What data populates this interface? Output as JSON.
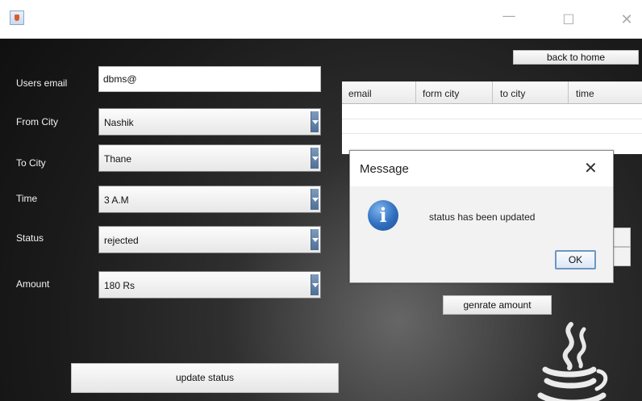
{
  "window": {
    "minimize_glyph": "—",
    "maximize_glyph": "☐",
    "close_glyph": "✕"
  },
  "form": {
    "email_label": "Users email",
    "email_value": "dbms@",
    "from_label": "From City",
    "from_value": "Nashik",
    "to_label": "To City",
    "to_value": "Thane",
    "time_label": "Time",
    "time_value": "3  A.M",
    "status_label": "Status",
    "status_value": "rejected",
    "amount_label": "Amount",
    "amount_value": "180 Rs",
    "update_button": "update status"
  },
  "actions": {
    "back_button": "back to home",
    "generate_button": "genrate amount"
  },
  "table": {
    "columns": [
      "email",
      "form city",
      "to city",
      "time"
    ]
  },
  "dialog": {
    "title": "Message",
    "close_glyph": "✕",
    "icon_letter": "i",
    "message": "status has been updated",
    "ok_button": "OK"
  },
  "icons": {
    "app": "java-app-icon",
    "info": "info-icon",
    "logo": "java-logo-icon"
  },
  "colors": {
    "accent": "#2f6fc0",
    "combo_arrow": "#5f7fa6",
    "background": "#202020"
  }
}
